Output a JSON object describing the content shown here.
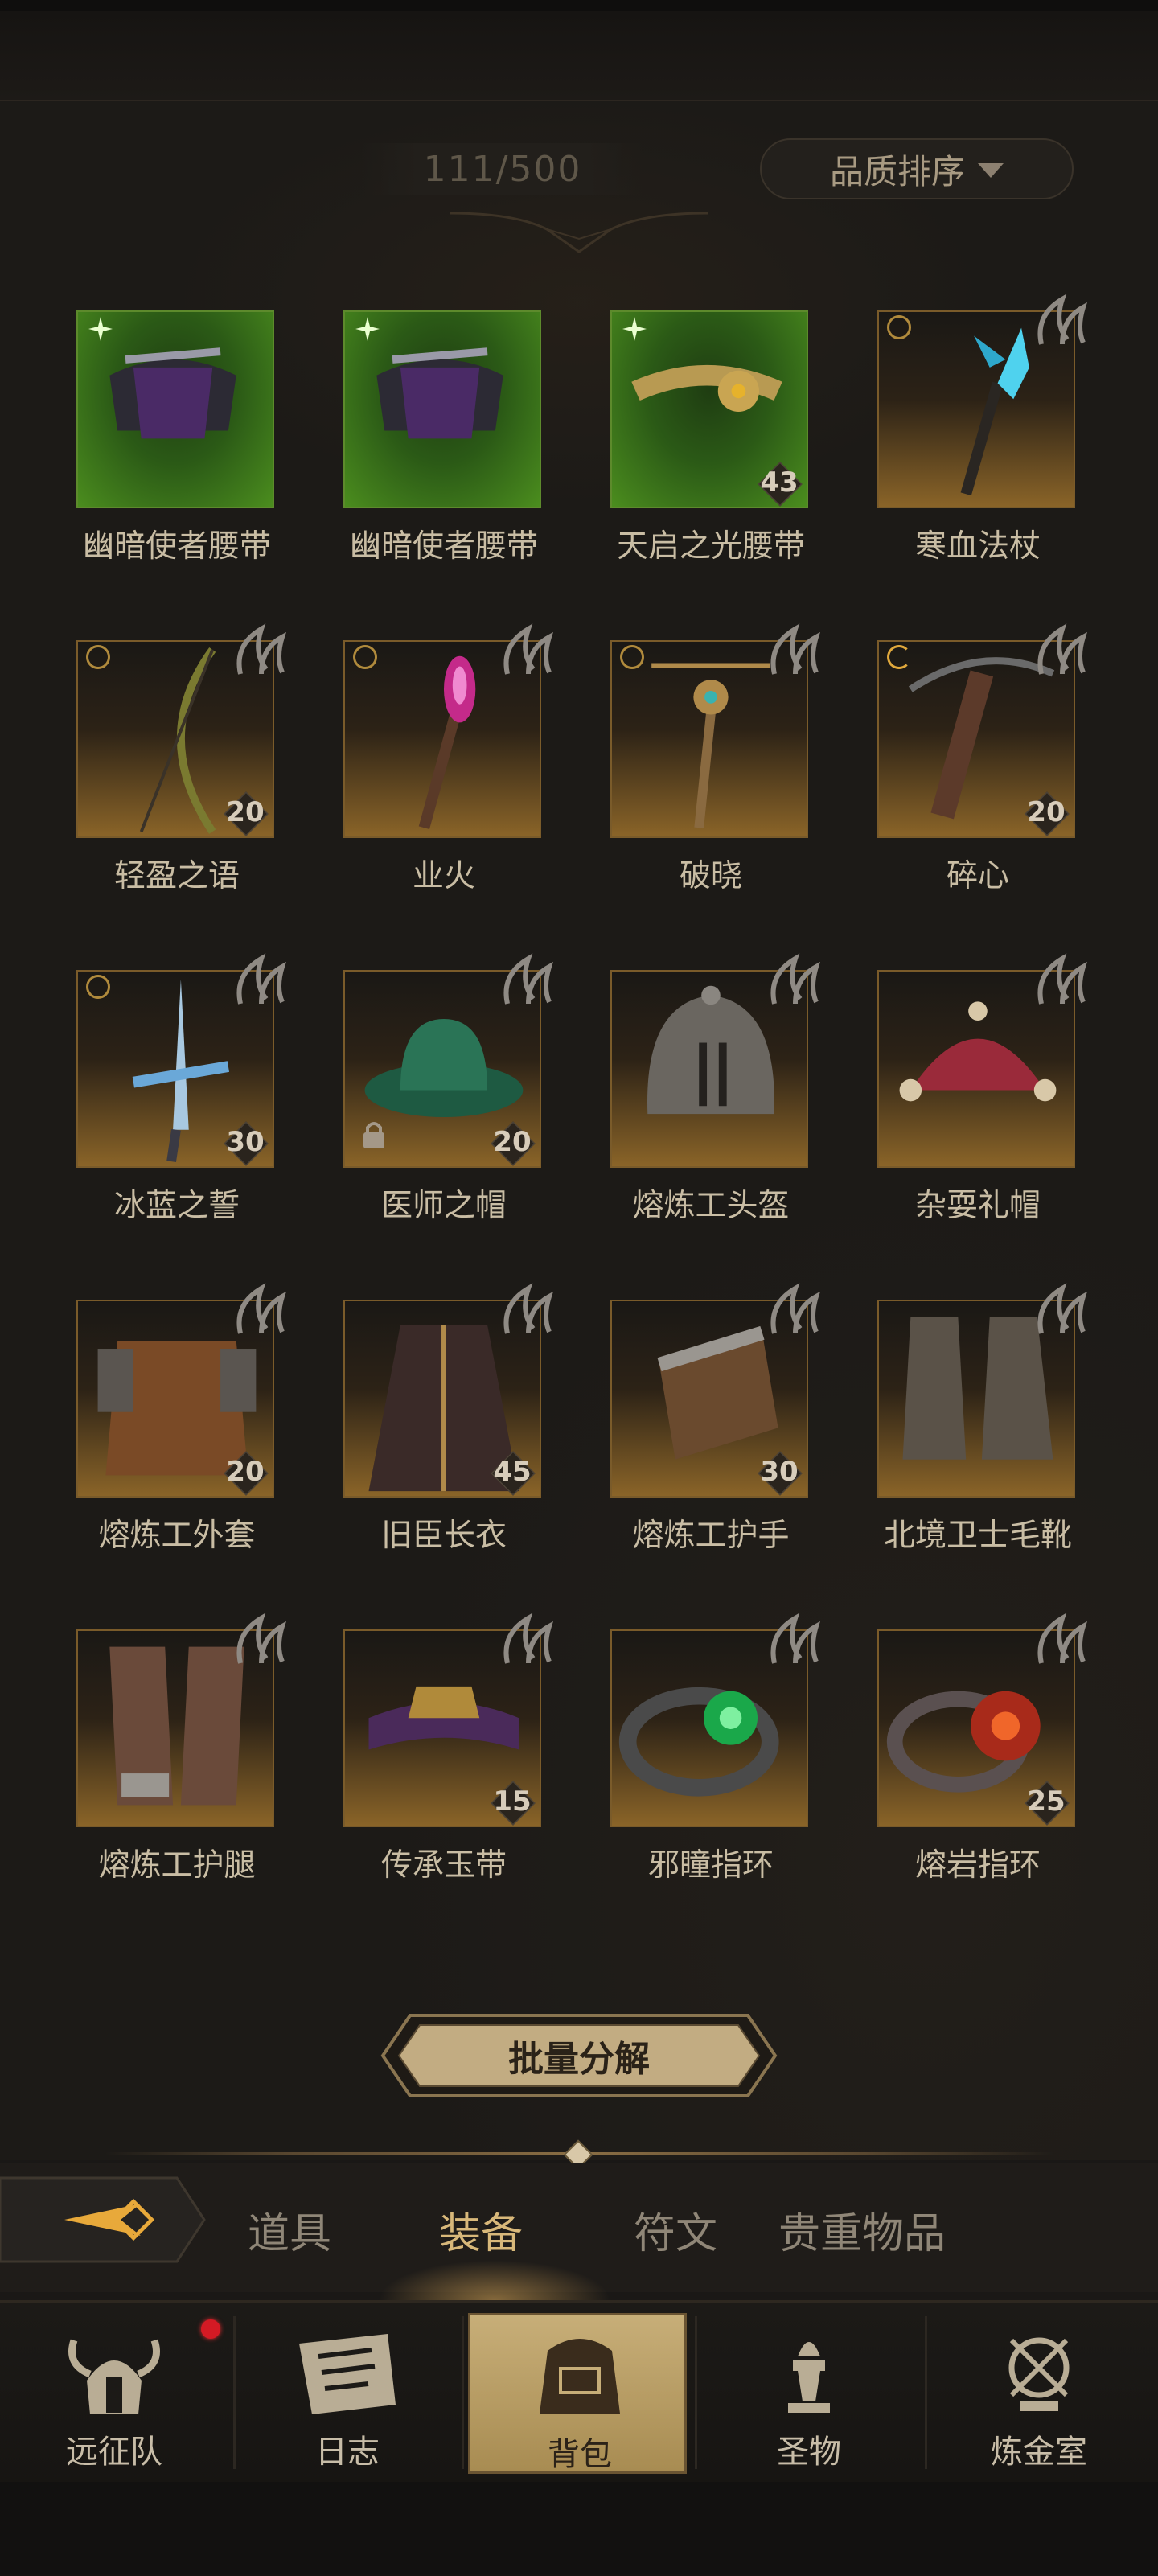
{
  "inventory": {
    "count": "111/500",
    "sort_label": "品质排序"
  },
  "items": [
    {
      "name": "幽暗使者腰带",
      "level": "",
      "quality": "green",
      "icon": "dark-belt-icon",
      "marker": ""
    },
    {
      "name": "幽暗使者腰带",
      "level": "",
      "quality": "green",
      "icon": "dark-belt-icon",
      "marker": ""
    },
    {
      "name": "天启之光腰带",
      "level": "43",
      "quality": "green",
      "icon": "golden-belt-icon",
      "marker": ""
    },
    {
      "name": "寒血法杖",
      "level": "",
      "quality": "gold",
      "icon": "ice-staff-icon",
      "marker": "circle"
    },
    {
      "name": "轻盈之语",
      "level": "20",
      "quality": "gold",
      "icon": "bow-icon",
      "marker": "circle"
    },
    {
      "name": "业火",
      "level": "",
      "quality": "gold",
      "icon": "fire-staff-icon",
      "marker": "circle"
    },
    {
      "name": "破晓",
      "level": "",
      "quality": "gold",
      "icon": "scepter-icon",
      "marker": "circle"
    },
    {
      "name": "碎心",
      "level": "20",
      "quality": "gold",
      "icon": "crossbow-icon",
      "marker": "crescent"
    },
    {
      "name": "冰蓝之誓",
      "level": "30",
      "quality": "gold",
      "icon": "ice-sword-icon",
      "marker": "circle"
    },
    {
      "name": "医师之帽",
      "level": "20",
      "quality": "gold",
      "icon": "hat-icon",
      "marker": "lock"
    },
    {
      "name": "熔炼工头盔",
      "level": "",
      "quality": "gold",
      "icon": "helmet-icon",
      "marker": ""
    },
    {
      "name": "杂耍礼帽",
      "level": "",
      "quality": "gold",
      "icon": "jester-hat-icon",
      "marker": ""
    },
    {
      "name": "熔炼工外套",
      "level": "20",
      "quality": "gold",
      "icon": "armor-coat-icon",
      "marker": ""
    },
    {
      "name": "旧臣长衣",
      "level": "45",
      "quality": "gold",
      "icon": "robe-icon",
      "marker": ""
    },
    {
      "name": "熔炼工护手",
      "level": "30",
      "quality": "gold",
      "icon": "gauntlet-icon",
      "marker": ""
    },
    {
      "name": "北境卫士毛靴",
      "level": "",
      "quality": "gold",
      "icon": "boots-icon",
      "marker": ""
    },
    {
      "name": "熔炼工护腿",
      "level": "",
      "quality": "gold",
      "icon": "leg-armor-icon",
      "marker": ""
    },
    {
      "name": "传承玉带",
      "level": "15",
      "quality": "gold",
      "icon": "jade-belt-icon",
      "marker": ""
    },
    {
      "name": "邪瞳指环",
      "level": "",
      "quality": "gold",
      "icon": "green-ring-icon",
      "marker": ""
    },
    {
      "name": "熔岩指环",
      "level": "25",
      "quality": "gold",
      "icon": "lava-ring-icon",
      "marker": ""
    }
  ],
  "actions": {
    "decompose_label": "批量分解"
  },
  "tabs": [
    {
      "label": "道具",
      "active": false
    },
    {
      "label": "装备",
      "active": true
    },
    {
      "label": "符文",
      "active": false
    },
    {
      "label": "贵重物品",
      "active": false
    }
  ],
  "nav": [
    {
      "label": "远征队",
      "icon": "viking-helmet-icon",
      "active": false,
      "badge": true
    },
    {
      "label": "日志",
      "icon": "journal-icon",
      "active": false,
      "badge": false
    },
    {
      "label": "背包",
      "icon": "backpack-icon",
      "active": true,
      "badge": false
    },
    {
      "label": "圣物",
      "icon": "relic-icon",
      "active": false,
      "badge": false
    },
    {
      "label": "炼金室",
      "icon": "alchemy-icon",
      "active": false,
      "badge": false
    }
  ],
  "colors": {
    "background": "#1c1a17",
    "tile_gold": "#8a6428",
    "tile_green": "#4b8d1e",
    "accent": "#d8b87a",
    "badge_red": "#d41a24"
  }
}
